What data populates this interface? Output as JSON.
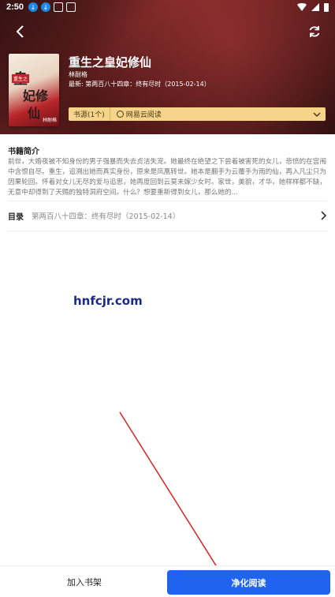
{
  "status_bar": {
    "time": "2:50"
  },
  "book": {
    "title": "重生之皇妃修仙",
    "author": "林耐格",
    "latest_prefix": "最新:",
    "latest_chapter": "第两百八十四章：终有尽时（2015-02-14）",
    "cover_text": {
      "line1": "皇",
      "line2": "妃修",
      "line3": "仙",
      "badge": "重生之",
      "author": "林耐格"
    }
  },
  "source": {
    "count_label": "书源(1个)",
    "name": "网易云阅读"
  },
  "intro": {
    "heading": "书籍简介",
    "text": "前世，大婚夜被不知身份的男子强暴而失去贞洁失宠。她最终在绝望之下尝着被害死的女儿，悲愤的在宫闱中含恨自尽。重生，追溯出她而真实身份，原来是凤凰转世。她本是翻手为云覆手为雨的仙，再入凡尘只为因果轮回。怀着对女儿无尽的爱与追思，她再度回到云莫未嫁少女时。家世，美貌，才华，她样样都不缺，无意中却得到了天赐的独特洞府空间。什么？想要重新得到女儿，那么她的..."
  },
  "toc": {
    "label": "目录",
    "latest": "第两百八十四章：终有尽时（2015-02-14）"
  },
  "watermark": "hnfcjr.com",
  "bottom": {
    "add_shelf": "加入书架",
    "read": "净化阅读"
  },
  "colors": {
    "accent": "#1f63f0",
    "source_bar": "#f6d48a",
    "arrow": "#e02020"
  }
}
